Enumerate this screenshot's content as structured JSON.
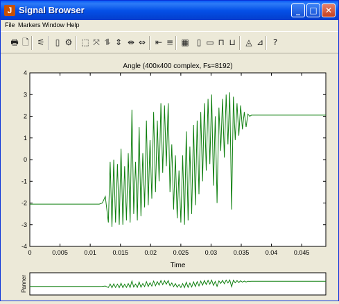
{
  "window": {
    "title": "Signal Browser",
    "app_icon_glyph": "J",
    "controls": {
      "minimize": "_",
      "maximize": "□",
      "close": "✕"
    }
  },
  "menu": [
    "File",
    "Markers",
    "Window",
    "Help"
  ],
  "toolbar": {
    "icons": [
      {
        "name": "print-icon",
        "glyph": "🖶"
      },
      {
        "name": "print-preview-icon",
        "glyph": "🗋"
      },
      {
        "name": "array-signals-icon",
        "glyph": "⚟"
      },
      {
        "name": "select-signal-icon",
        "glyph": "▯"
      },
      {
        "name": "signal-properties-icon",
        "glyph": "⚙"
      },
      {
        "name": "zoom-box-icon",
        "glyph": "⬚"
      },
      {
        "name": "zoom-fit-icon",
        "glyph": "⤧"
      },
      {
        "name": "zoom-vertical-icon",
        "glyph": "⥮"
      },
      {
        "name": "zoom-vertical-out-icon",
        "glyph": "⇕"
      },
      {
        "name": "zoom-horizontal-icon",
        "glyph": "⇹"
      },
      {
        "name": "zoom-horizontal-out-icon",
        "glyph": "⇔"
      },
      {
        "name": "marker-vertical-icon",
        "glyph": "⇤"
      },
      {
        "name": "marker-horizontal-icon",
        "glyph": "≡"
      },
      {
        "name": "markers-icon",
        "glyph": "▦"
      },
      {
        "name": "marker-mode-1-icon",
        "glyph": "▯"
      },
      {
        "name": "marker-mode-2-icon",
        "glyph": "▭"
      },
      {
        "name": "marker-peaks-icon",
        "glyph": "⊓"
      },
      {
        "name": "marker-valleys-icon",
        "glyph": "⊔"
      },
      {
        "name": "marker-track-icon",
        "glyph": "◬"
      },
      {
        "name": "marker-slope-icon",
        "glyph": "⊿"
      },
      {
        "name": "help-icon",
        "glyph": "?"
      }
    ]
  },
  "chart_data": {
    "type": "line",
    "title": "Angle (400x400 complex, Fs=8192)",
    "xlabel": "Time",
    "ylabel": "",
    "xlim": [
      0,
      0.049
    ],
    "ylim": [
      -4,
      4
    ],
    "xticks": [
      "0",
      "0.005",
      "0.01",
      "0.015",
      "0.02",
      "0.025",
      "0.03",
      "0.035",
      "0.04",
      "0.045"
    ],
    "yticks": [
      "4",
      "3",
      "2",
      "1",
      "0",
      "-1",
      "-2",
      "-3",
      "-4"
    ],
    "grid": false,
    "line_color": "#108010",
    "series": [
      {
        "x": [
          0,
          0.0115,
          0.012,
          0.0125,
          0.013,
          0.0133,
          0.0136,
          0.0139,
          0.0142,
          0.0145,
          0.0148,
          0.0151,
          0.0154,
          0.0157,
          0.016,
          0.0163,
          0.0166,
          0.0169,
          0.0172,
          0.0175,
          0.0178,
          0.0181,
          0.0184,
          0.0187,
          0.019,
          0.0193,
          0.0196,
          0.0199,
          0.0202,
          0.0205,
          0.0208,
          0.0211,
          0.0214,
          0.0217,
          0.022,
          0.0223,
          0.0226,
          0.0229,
          0.0232,
          0.0235,
          0.0238,
          0.0241,
          0.0244,
          0.0247,
          0.025,
          0.0253,
          0.0256,
          0.0259,
          0.0262,
          0.0265,
          0.0268,
          0.0271,
          0.0274,
          0.0277,
          0.028,
          0.0283,
          0.0286,
          0.0289,
          0.0292,
          0.0295,
          0.0298,
          0.0301,
          0.0304,
          0.0307,
          0.031,
          0.0313,
          0.0316,
          0.0319,
          0.0322,
          0.0325,
          0.0328,
          0.0331,
          0.0334,
          0.0337,
          0.034,
          0.0343,
          0.0346,
          0.0349,
          0.0352,
          0.0355,
          0.0358,
          0.0361,
          0.0364,
          0.0367,
          0.037,
          0.049
        ],
        "y": [
          -2.05,
          -2.05,
          -2.0,
          -1.7,
          -2.9,
          -0.1,
          -3.1,
          0.0,
          -2.9,
          -0.2,
          -3.0,
          0.5,
          -3.0,
          -0.3,
          -2.8,
          0.3,
          -2.9,
          2.3,
          -2.5,
          -0.1,
          -2.8,
          1.5,
          -2.6,
          0.3,
          -2.2,
          1.8,
          -2.1,
          0.9,
          -1.8,
          2.2,
          -1.5,
          1.8,
          -1.0,
          2.6,
          -0.6,
          2.5,
          -0.3,
          2.6,
          -1.5,
          0.7,
          -2.3,
          0.2,
          -2.7,
          -0.5,
          -2.9,
          0.2,
          -3.0,
          1.3,
          -2.8,
          0.6,
          -2.5,
          1.6,
          -2.1,
          1.8,
          -1.6,
          2.2,
          -1.0,
          2.6,
          -0.5,
          2.8,
          -0.2,
          3.0,
          -1.2,
          2.0,
          -2.0,
          2.4,
          0.4,
          2.8,
          0.1,
          3.0,
          0.7,
          3.1,
          -2.3,
          2.9,
          0.9,
          2.6,
          1.1,
          2.5,
          1.4,
          2.2,
          1.5,
          2.1,
          2.0,
          2.05,
          2.05,
          2.05
        ]
      }
    ]
  },
  "panner": {
    "label": "Panner"
  }
}
